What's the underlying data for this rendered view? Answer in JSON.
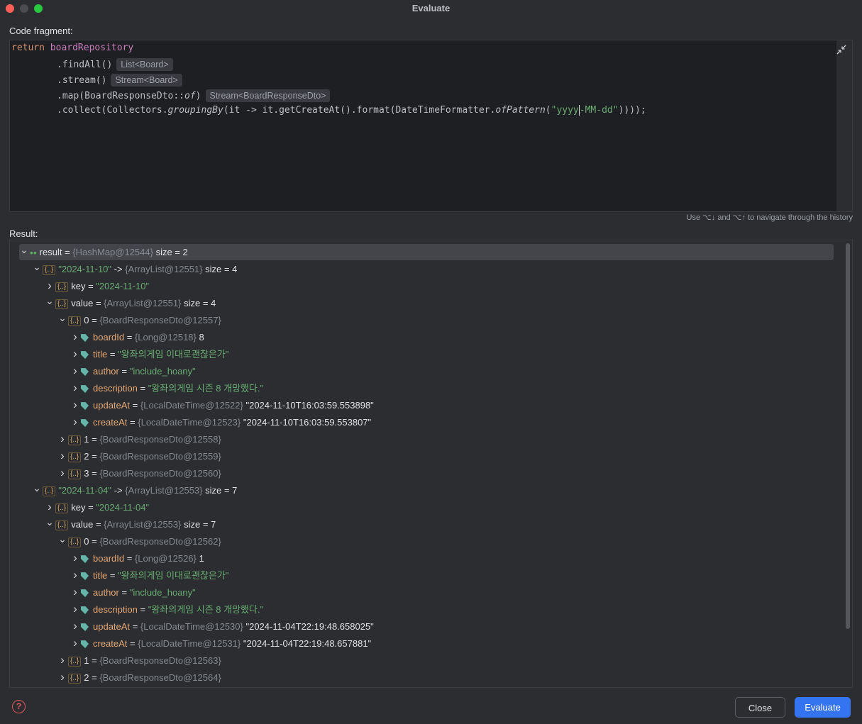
{
  "window": {
    "title": "Evaluate"
  },
  "code_fragment": {
    "label": "Code fragment:",
    "lines": [
      {
        "kw": "return",
        "field": "boardRepository"
      },
      {
        "text": ".findAll()",
        "hint": "List<Board>"
      },
      {
        "text": ".stream()",
        "hint": "Stream<Board>"
      },
      {
        "text_a": ".map(BoardResponseDto::",
        "text_b": "of",
        "text_c": ")",
        "hint": "Stream<BoardResponseDto>"
      },
      {
        "a": ".collect(Collectors.",
        "b": "groupingBy",
        "c": "(it -> it.getCreateAt().format(DateTimeFormatter.",
        "d": "ofPattern",
        "e": "(",
        "f": "\"yyyy",
        "g": "-MM-dd\"",
        "h": "))));"
      }
    ],
    "history_hint": "Use ⌥↓ and ⌥↑ to navigate through the history",
    "collapse_icon": "collapse-icon"
  },
  "result": {
    "label": "Result:",
    "rows": [
      {
        "name": "result",
        "ref": "{HashMap@12544}",
        "extra": "size = 2"
      },
      {
        "name": "\"2024-11-10\"",
        "arrow_text": "->",
        "ref": "{ArrayList@12551}",
        "extra": "size = 4"
      },
      {
        "name": "key",
        "value": "\"2024-11-10\""
      },
      {
        "name": "value",
        "ref": "{ArrayList@12551}",
        "extra": "size = 4"
      },
      {
        "name": "0",
        "ref": "{BoardResponseDto@12557}"
      },
      {
        "name": "boardId",
        "ref": "{Long@12518}",
        "extra": "8"
      },
      {
        "name": "title",
        "value": "\"왕좌의게임 이대로괜찮은가\""
      },
      {
        "name": "author",
        "value": "\"include_hoany\""
      },
      {
        "name": "description",
        "value": "\"왕좌의게임 시즌 8 개망했다.\""
      },
      {
        "name": "updateAt",
        "ref": "{LocalDateTime@12522}",
        "extra": "\"2024-11-10T16:03:59.553898\""
      },
      {
        "name": "createAt",
        "ref": "{LocalDateTime@12523}",
        "extra": "\"2024-11-10T16:03:59.553807\""
      },
      {
        "name": "1",
        "ref": "{BoardResponseDto@12558}"
      },
      {
        "name": "2",
        "ref": "{BoardResponseDto@12559}"
      },
      {
        "name": "3",
        "ref": "{BoardResponseDto@12560}"
      },
      {
        "name": "\"2024-11-04\"",
        "arrow_text": "->",
        "ref": "{ArrayList@12553}",
        "extra": "size = 7"
      },
      {
        "name": "key",
        "value": "\"2024-11-04\""
      },
      {
        "name": "value",
        "ref": "{ArrayList@12553}",
        "extra": "size = 7"
      },
      {
        "name": "0",
        "ref": "{BoardResponseDto@12562}"
      },
      {
        "name": "boardId",
        "ref": "{Long@12526}",
        "extra": "1"
      },
      {
        "name": "title",
        "value": "\"왕좌의게임 이대로괜찮은가\""
      },
      {
        "name": "author",
        "value": "\"include_hoany\""
      },
      {
        "name": "description",
        "value": "\"왕좌의게임 시즌 8 개망했다.\""
      },
      {
        "name": "updateAt",
        "ref": "{LocalDateTime@12530}",
        "extra": "\"2024-11-04T22:19:48.658025\""
      },
      {
        "name": "createAt",
        "ref": "{LocalDateTime@12531}",
        "extra": "\"2024-11-04T22:19:48.657881\""
      },
      {
        "name": "1",
        "ref": "{BoardResponseDto@12563}"
      },
      {
        "name": "2",
        "ref": "{BoardResponseDto@12564}"
      }
    ]
  },
  "footer": {
    "help_icon": "?",
    "close_label": "Close",
    "evaluate_label": "Evaluate"
  },
  "colors": {
    "background": "#2b2d30",
    "editor_bg": "#1e1f22",
    "accent_button": "#3574f0",
    "string": "#6aab73",
    "field_name": "#e6a874"
  }
}
